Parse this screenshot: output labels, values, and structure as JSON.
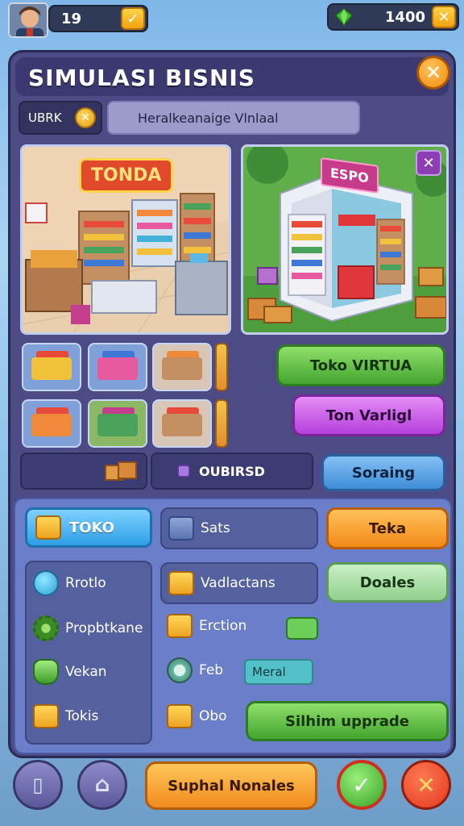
{
  "hud": {
    "level": "19",
    "gems": "1400",
    "colors": {
      "gem": "#3cbb33",
      "accent": "#f2a20f"
    }
  },
  "panel": {
    "title": "SIMULASI BISNIS",
    "tab_left": "UBRK",
    "search_text": "Heralkeanaige Vlnlaal"
  },
  "scenes": {
    "store_sign": "TONDA",
    "virtual_sign": "ESPO"
  },
  "buttons": {
    "toko_virtual": "Toko VIRTUA",
    "ton_varligi": "Ton Varligl",
    "bar_center": "OUBIRSD",
    "soraing": "Soraing",
    "toko_tab": "TOKO",
    "sats": "Sats",
    "teka": "Teka",
    "vadlactans": "Vadlactans",
    "doales": "Doales",
    "erction": "Erction",
    "feb": "Feb",
    "meral": "Meral",
    "obo": "Obo",
    "silhim_upgrade": "Silhim upprade"
  },
  "menu_left": [
    {
      "label": "Rrotlo",
      "icon": "coin-stack-icon"
    },
    {
      "label": "Propbtkane",
      "icon": "gear-icon"
    },
    {
      "label": "Vekan",
      "icon": "jar-icon"
    },
    {
      "label": "Tokis",
      "icon": "box-icon"
    }
  ],
  "bottom": {
    "main_button": "Suphal Nonales"
  }
}
